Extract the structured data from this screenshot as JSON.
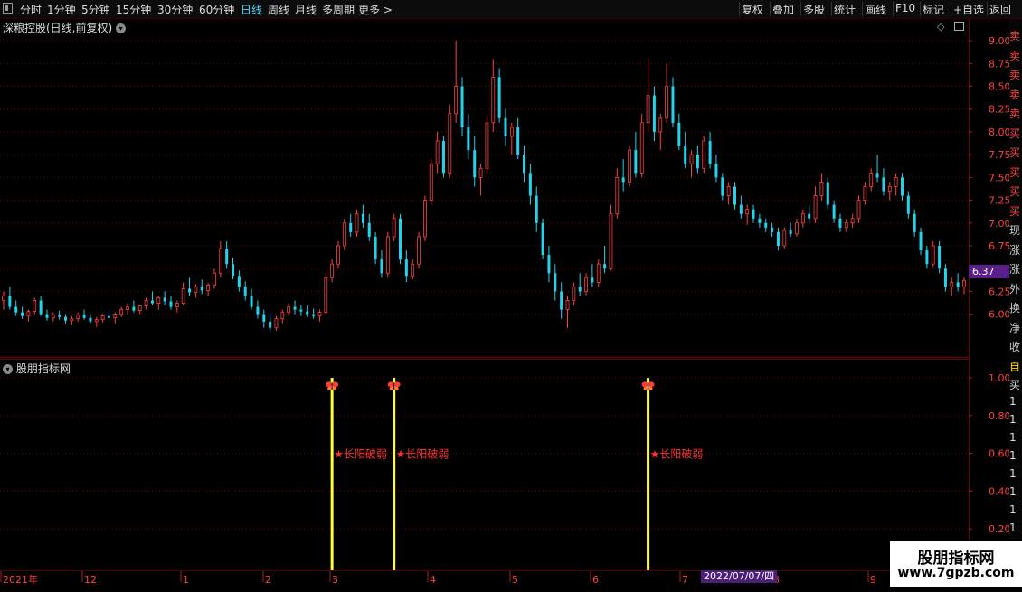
{
  "toolbar": {
    "periods": [
      "分时",
      "1分钟",
      "5分钟",
      "15分钟",
      "30分钟",
      "60分钟",
      "日线",
      "周线",
      "月线",
      "多周期",
      "更多 >"
    ],
    "active_period": "日线",
    "tools": [
      "复权",
      "叠加",
      "多股",
      "统计",
      "画线",
      "F10",
      "标记",
      "+自选",
      "返回"
    ]
  },
  "main_chart": {
    "title": "深粮控股(日线,前复权)",
    "current_price": "6.37",
    "y_ticks": [
      "9.00",
      "8.75",
      "8.50",
      "8.25",
      "8.00",
      "7.75",
      "7.50",
      "7.25",
      "7.00",
      "6.75",
      "6.50",
      "6.25",
      "6.00"
    ]
  },
  "indicator": {
    "title": "股朋指标网",
    "y_ticks": [
      "1.00",
      "0.80",
      "0.60",
      "0.40",
      "0.20"
    ],
    "signal_label": "长阳破弱",
    "signal_count": 3
  },
  "date_axis": {
    "labels": [
      "2021年",
      "12",
      "1",
      "2",
      "3",
      "4",
      "5",
      "6",
      "7",
      "8",
      "9"
    ],
    "cursor_date": "2022/07/07/四"
  },
  "right_strip": {
    "chars": [
      "卖",
      "卖",
      "卖",
      "卖",
      "卖",
      "买",
      "买",
      "买",
      "买",
      "买",
      "现",
      "涨",
      "涨",
      "外",
      "换",
      "净",
      "收"
    ],
    "lower_chars": [
      "自",
      "买",
      "1",
      "1",
      "1",
      "1",
      "1",
      "1",
      "1",
      "1"
    ]
  },
  "watermark": {
    "name": "股朋指标网",
    "url": "www.7gpzb.com"
  },
  "colors": {
    "up": "#ff4040",
    "down": "#22d3ee",
    "signal": "#ffff33",
    "grid": "#6a0000",
    "axis_text": "#ff4040"
  },
  "chart_data": {
    "type": "candlestick",
    "title": "深粮控股(日线,前复权)",
    "ylim": [
      5.6,
      9.1
    ],
    "ohlc": [
      [
        6.15,
        6.25,
        6.05,
        6.2
      ],
      [
        6.2,
        6.3,
        6.05,
        6.08
      ],
      [
        6.08,
        6.15,
        5.98,
        6.02
      ],
      [
        6.02,
        6.08,
        5.95,
        5.98
      ],
      [
        5.98,
        6.05,
        5.92,
        6.03
      ],
      [
        6.03,
        6.18,
        6.0,
        6.15
      ],
      [
        6.15,
        6.2,
        5.98,
        6.0
      ],
      [
        6.0,
        6.05,
        5.93,
        5.96
      ],
      [
        5.96,
        6.02,
        5.92,
        5.99
      ],
      [
        5.99,
        6.04,
        5.94,
        5.97
      ],
      [
        5.97,
        6.0,
        5.9,
        5.93
      ],
      [
        5.93,
        5.98,
        5.88,
        5.95
      ],
      [
        5.95,
        6.02,
        5.92,
        5.99
      ],
      [
        5.99,
        6.05,
        5.94,
        5.96
      ],
      [
        5.96,
        6.0,
        5.9,
        5.92
      ],
      [
        5.92,
        5.97,
        5.86,
        5.94
      ],
      [
        5.94,
        6.0,
        5.91,
        5.98
      ],
      [
        5.98,
        6.04,
        5.94,
        5.96
      ],
      [
        5.96,
        6.02,
        5.9,
        6.0
      ],
      [
        6.0,
        6.08,
        5.97,
        6.05
      ],
      [
        6.05,
        6.12,
        6.0,
        6.08
      ],
      [
        6.08,
        6.15,
        6.02,
        6.04
      ],
      [
        6.04,
        6.1,
        6.0,
        6.09
      ],
      [
        6.09,
        6.18,
        6.05,
        6.15
      ],
      [
        6.15,
        6.25,
        6.1,
        6.12
      ],
      [
        6.12,
        6.2,
        6.05,
        6.18
      ],
      [
        6.18,
        6.25,
        6.1,
        6.14
      ],
      [
        6.14,
        6.2,
        6.05,
        6.08
      ],
      [
        6.08,
        6.15,
        6.02,
        6.12
      ],
      [
        6.12,
        6.35,
        6.1,
        6.28
      ],
      [
        6.28,
        6.4,
        6.2,
        6.24
      ],
      [
        6.24,
        6.33,
        6.18,
        6.3
      ],
      [
        6.3,
        6.38,
        6.22,
        6.26
      ],
      [
        6.26,
        6.34,
        6.2,
        6.32
      ],
      [
        6.32,
        6.5,
        6.28,
        6.45
      ],
      [
        6.45,
        6.8,
        6.4,
        6.72
      ],
      [
        6.72,
        6.8,
        6.5,
        6.55
      ],
      [
        6.55,
        6.62,
        6.38,
        6.42
      ],
      [
        6.42,
        6.48,
        6.25,
        6.3
      ],
      [
        6.3,
        6.36,
        6.15,
        6.2
      ],
      [
        6.2,
        6.28,
        6.05,
        6.08
      ],
      [
        6.08,
        6.15,
        5.95,
        6.0
      ],
      [
        6.0,
        6.05,
        5.85,
        5.92
      ],
      [
        5.92,
        6.0,
        5.8,
        5.85
      ],
      [
        5.85,
        5.98,
        5.82,
        5.95
      ],
      [
        5.95,
        6.05,
        5.9,
        6.02
      ],
      [
        6.02,
        6.12,
        5.98,
        6.08
      ],
      [
        6.08,
        6.15,
        6.0,
        6.05
      ],
      [
        6.05,
        6.1,
        5.98,
        6.03
      ],
      [
        6.03,
        6.1,
        5.97,
        6.0
      ],
      [
        6.0,
        6.06,
        5.95,
        5.98
      ],
      [
        5.98,
        6.05,
        5.92,
        6.02
      ],
      [
        6.02,
        6.45,
        6.0,
        6.4
      ],
      [
        6.4,
        6.6,
        6.35,
        6.55
      ],
      [
        6.55,
        6.8,
        6.5,
        6.75
      ],
      [
        6.75,
        7.05,
        6.7,
        7.0
      ],
      [
        7.0,
        7.1,
        6.85,
        6.9
      ],
      [
        6.9,
        7.15,
        6.85,
        7.1
      ],
      [
        7.1,
        7.2,
        6.95,
        7.0
      ],
      [
        7.0,
        7.1,
        6.8,
        6.85
      ],
      [
        6.85,
        6.9,
        6.55,
        6.6
      ],
      [
        6.6,
        6.7,
        6.4,
        6.45
      ],
      [
        6.45,
        6.9,
        6.4,
        6.85
      ],
      [
        6.85,
        7.1,
        6.8,
        7.05
      ],
      [
        7.05,
        7.1,
        6.55,
        6.6
      ],
      [
        6.6,
        6.7,
        6.35,
        6.42
      ],
      [
        6.42,
        6.6,
        6.38,
        6.55
      ],
      [
        6.55,
        6.9,
        6.5,
        6.85
      ],
      [
        6.85,
        7.3,
        6.8,
        7.25
      ],
      [
        7.25,
        7.7,
        7.2,
        7.65
      ],
      [
        7.65,
        8.0,
        7.55,
        7.9
      ],
      [
        7.9,
        7.95,
        7.5,
        7.55
      ],
      [
        7.55,
        8.3,
        7.5,
        8.2
      ],
      [
        8.2,
        9.0,
        8.1,
        8.5
      ],
      [
        8.5,
        8.6,
        7.95,
        8.05
      ],
      [
        8.05,
        8.2,
        7.7,
        7.8
      ],
      [
        7.8,
        7.95,
        7.4,
        7.5
      ],
      [
        7.5,
        7.65,
        7.3,
        7.6
      ],
      [
        7.6,
        8.2,
        7.55,
        8.1
      ],
      [
        8.1,
        8.8,
        8.0,
        8.6
      ],
      [
        8.6,
        8.7,
        8.1,
        8.15
      ],
      [
        8.15,
        8.25,
        7.85,
        7.95
      ],
      [
        7.95,
        8.1,
        7.75,
        8.05
      ],
      [
        8.05,
        8.15,
        7.7,
        7.75
      ],
      [
        7.75,
        7.85,
        7.45,
        7.55
      ],
      [
        7.55,
        7.65,
        7.2,
        7.3
      ],
      [
        7.3,
        7.4,
        6.9,
        7.0
      ],
      [
        7.0,
        7.05,
        6.6,
        6.65
      ],
      [
        6.65,
        6.75,
        6.35,
        6.45
      ],
      [
        6.45,
        6.55,
        6.15,
        6.25
      ],
      [
        6.25,
        6.35,
        5.95,
        6.05
      ],
      [
        6.05,
        6.2,
        5.85,
        6.15
      ],
      [
        6.15,
        6.35,
        6.1,
        6.3
      ],
      [
        6.3,
        6.45,
        6.2,
        6.25
      ],
      [
        6.25,
        6.45,
        6.2,
        6.4
      ],
      [
        6.4,
        6.55,
        6.3,
        6.35
      ],
      [
        6.35,
        6.6,
        6.3,
        6.55
      ],
      [
        6.55,
        6.75,
        6.45,
        6.5
      ],
      [
        6.5,
        7.2,
        6.48,
        7.1
      ],
      [
        7.1,
        7.6,
        7.05,
        7.5
      ],
      [
        7.5,
        7.7,
        7.35,
        7.45
      ],
      [
        7.45,
        7.85,
        7.4,
        7.8
      ],
      [
        7.8,
        8.0,
        7.5,
        7.55
      ],
      [
        7.55,
        8.2,
        7.5,
        8.1
      ],
      [
        8.1,
        8.8,
        8.0,
        8.4
      ],
      [
        8.4,
        8.5,
        7.9,
        8.0
      ],
      [
        8.0,
        8.2,
        7.8,
        8.15
      ],
      [
        8.15,
        8.75,
        8.1,
        8.5
      ],
      [
        8.5,
        8.6,
        8.05,
        8.1
      ],
      [
        8.1,
        8.2,
        7.8,
        7.85
      ],
      [
        7.85,
        8.0,
        7.6,
        7.65
      ],
      [
        7.65,
        7.8,
        7.5,
        7.75
      ],
      [
        7.75,
        7.85,
        7.55,
        7.6
      ],
      [
        7.6,
        7.95,
        7.55,
        7.9
      ],
      [
        7.9,
        8.0,
        7.6,
        7.65
      ],
      [
        7.65,
        7.75,
        7.45,
        7.5
      ],
      [
        7.5,
        7.55,
        7.25,
        7.3
      ],
      [
        7.3,
        7.45,
        7.2,
        7.4
      ],
      [
        7.4,
        7.45,
        7.15,
        7.2
      ],
      [
        7.2,
        7.3,
        7.05,
        7.1
      ],
      [
        7.1,
        7.2,
        6.98,
        7.15
      ],
      [
        7.15,
        7.2,
        7.0,
        7.05
      ],
      [
        7.05,
        7.1,
        6.95,
        7.0
      ],
      [
        7.0,
        7.05,
        6.9,
        6.95
      ],
      [
        6.95,
        7.0,
        6.85,
        6.9
      ],
      [
        6.9,
        6.95,
        6.7,
        6.75
      ],
      [
        6.75,
        6.95,
        6.72,
        6.92
      ],
      [
        6.92,
        7.0,
        6.85,
        6.88
      ],
      [
        6.88,
        7.05,
        6.85,
        7.0
      ],
      [
        7.0,
        7.15,
        6.95,
        7.1
      ],
      [
        7.1,
        7.2,
        7.0,
        7.05
      ],
      [
        7.05,
        7.4,
        7.0,
        7.3
      ],
      [
        7.3,
        7.55,
        7.25,
        7.45
      ],
      [
        7.45,
        7.5,
        7.15,
        7.2
      ],
      [
        7.2,
        7.25,
        7.0,
        7.05
      ],
      [
        7.05,
        7.1,
        6.9,
        6.95
      ],
      [
        6.95,
        7.05,
        6.9,
        7.0
      ],
      [
        7.0,
        7.1,
        6.95,
        7.05
      ],
      [
        7.05,
        7.3,
        7.0,
        7.25
      ],
      [
        7.25,
        7.45,
        7.2,
        7.4
      ],
      [
        7.4,
        7.6,
        7.35,
        7.55
      ],
      [
        7.55,
        7.75,
        7.45,
        7.5
      ],
      [
        7.5,
        7.6,
        7.3,
        7.35
      ],
      [
        7.35,
        7.45,
        7.25,
        7.4
      ],
      [
        7.4,
        7.55,
        7.3,
        7.5
      ],
      [
        7.5,
        7.55,
        7.25,
        7.3
      ],
      [
        7.3,
        7.35,
        7.05,
        7.1
      ],
      [
        7.1,
        7.15,
        6.85,
        6.9
      ],
      [
        6.9,
        6.95,
        6.65,
        6.7
      ],
      [
        6.7,
        6.75,
        6.5,
        6.55
      ],
      [
        6.55,
        6.8,
        6.52,
        6.75
      ],
      [
        6.75,
        6.8,
        6.45,
        6.5
      ],
      [
        6.5,
        6.55,
        6.25,
        6.3
      ],
      [
        6.3,
        6.4,
        6.2,
        6.35
      ],
      [
        6.35,
        6.45,
        6.25,
        6.3
      ],
      [
        6.3,
        6.4,
        6.22,
        6.37
      ]
    ]
  }
}
